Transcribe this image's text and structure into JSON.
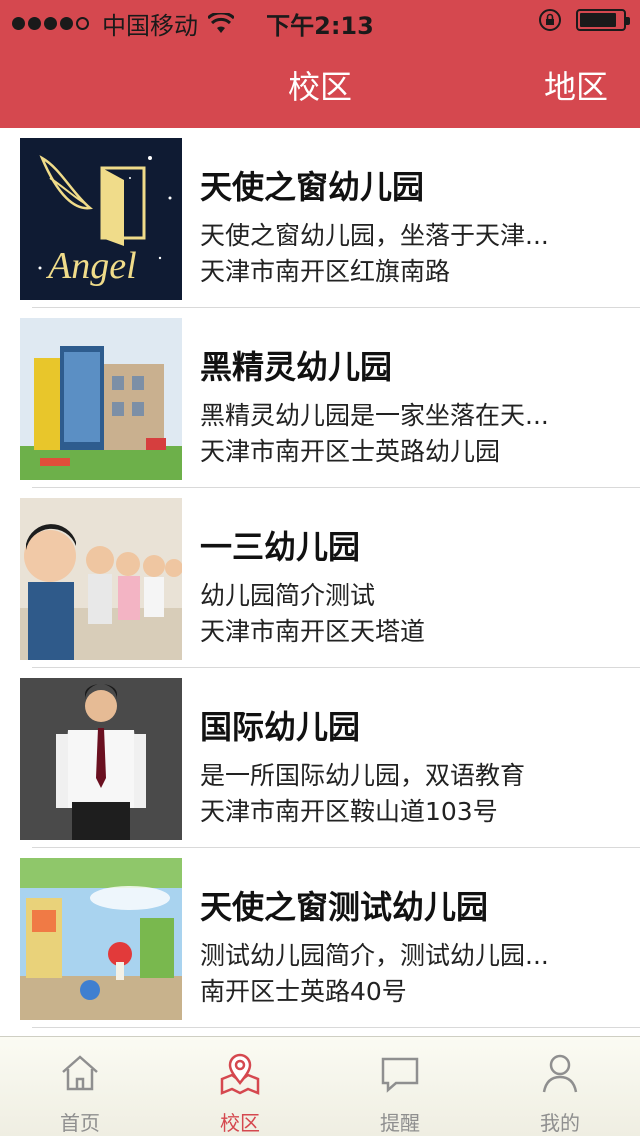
{
  "status_bar": {
    "carrier": "中国移动",
    "time": "下午2:13"
  },
  "nav": {
    "title": "校区",
    "right_label": "地区"
  },
  "colors": {
    "brand": "#d5484f",
    "tab_inactive": "#8f8f8f"
  },
  "schools": [
    {
      "name": "天使之窗幼儿园",
      "description": "天使之窗幼儿园，坐落于天津...",
      "address": "天津市南开区红旗南路",
      "image": "angel-logo"
    },
    {
      "name": "黑精灵幼儿园",
      "description": "黑精灵幼儿园是一家坐落在天...",
      "address": "天津市南开区士英路幼儿园",
      "image": "building-photo"
    },
    {
      "name": "一三幼儿园",
      "description": "幼儿园简介测试",
      "address": "天津市南开区天塔道",
      "image": "children-photo"
    },
    {
      "name": "国际幼儿园",
      "description": "是一所国际幼儿园，双语教育",
      "address": "天津市南开区鞍山道103号",
      "image": "man-portrait-photo"
    },
    {
      "name": "天使之窗测试幼儿园",
      "description": "测试幼儿园简介，测试幼儿园...",
      "address": "南开区士英路40号",
      "image": "playroom-photo"
    }
  ],
  "tabs": [
    {
      "label": "首页",
      "icon": "home-icon",
      "active": false
    },
    {
      "label": "校区",
      "icon": "map-pin-icon",
      "active": true
    },
    {
      "label": "提醒",
      "icon": "message-icon",
      "active": false
    },
    {
      "label": "我的",
      "icon": "user-icon",
      "active": false
    }
  ]
}
